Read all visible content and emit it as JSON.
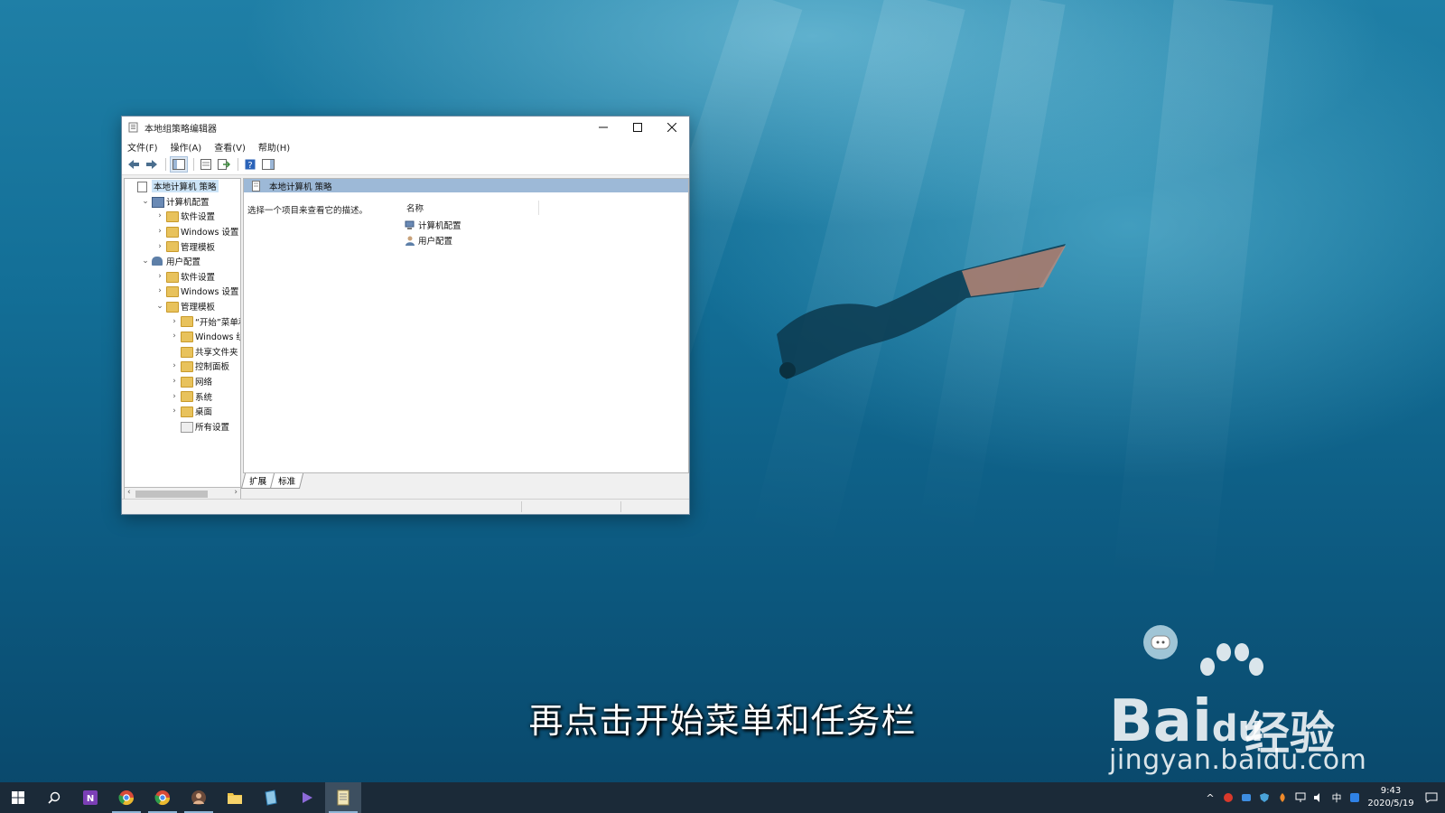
{
  "window": {
    "title": "本地组策略编辑器",
    "menu": [
      "文件(F)",
      "操作(A)",
      "查看(V)",
      "帮助(H)"
    ]
  },
  "tree": {
    "items": [
      {
        "label": "本地计算机 策略",
        "level": 0,
        "chevron": "",
        "icon": "policy",
        "selected": true
      },
      {
        "label": "计算机配置",
        "level": 1,
        "chevron": "expanded",
        "icon": "computer"
      },
      {
        "label": "软件设置",
        "level": 2,
        "chevron": "collapsed",
        "icon": "folder"
      },
      {
        "label": "Windows 设置",
        "level": 2,
        "chevron": "collapsed",
        "icon": "folder"
      },
      {
        "label": "管理模板",
        "level": 2,
        "chevron": "collapsed",
        "icon": "folder"
      },
      {
        "label": "用户配置",
        "level": 1,
        "chevron": "expanded",
        "icon": "user"
      },
      {
        "label": "软件设置",
        "level": 2,
        "chevron": "collapsed",
        "icon": "folder"
      },
      {
        "label": "Windows 设置",
        "level": 2,
        "chevron": "collapsed",
        "icon": "folder"
      },
      {
        "label": "管理模板",
        "level": 2,
        "chevron": "expanded",
        "icon": "folder"
      },
      {
        "label": "“开始”菜单和",
        "level": 3,
        "chevron": "collapsed",
        "icon": "folder"
      },
      {
        "label": "Windows 组",
        "level": 3,
        "chevron": "collapsed",
        "icon": "folder"
      },
      {
        "label": "共享文件夹",
        "level": 3,
        "chevron": "",
        "icon": "folder"
      },
      {
        "label": "控制面板",
        "level": 3,
        "chevron": "collapsed",
        "icon": "folder"
      },
      {
        "label": "网络",
        "level": 3,
        "chevron": "collapsed",
        "icon": "folder"
      },
      {
        "label": "系统",
        "level": 3,
        "chevron": "collapsed",
        "icon": "folder"
      },
      {
        "label": "桌面",
        "level": 3,
        "chevron": "collapsed",
        "icon": "folder"
      },
      {
        "label": "所有设置",
        "level": 3,
        "chevron": "",
        "icon": "settings"
      }
    ]
  },
  "right": {
    "header": "本地计算机 策略",
    "description": "选择一个项目来查看它的描述。",
    "column_name": "名称",
    "items": [
      "计算机配置",
      "用户配置"
    ]
  },
  "tabs": [
    "扩展",
    "标准"
  ],
  "overlay": {
    "subtitle": "再点击开始菜单和任务栏",
    "watermark_brand": "Bai",
    "watermark_brand_du": "du",
    "watermark_jingyan": "经验",
    "watermark_url": "jingyan.baidu.com"
  },
  "taskbar": {
    "time": "9:43",
    "date": "2020/5/19",
    "ime": "中"
  }
}
